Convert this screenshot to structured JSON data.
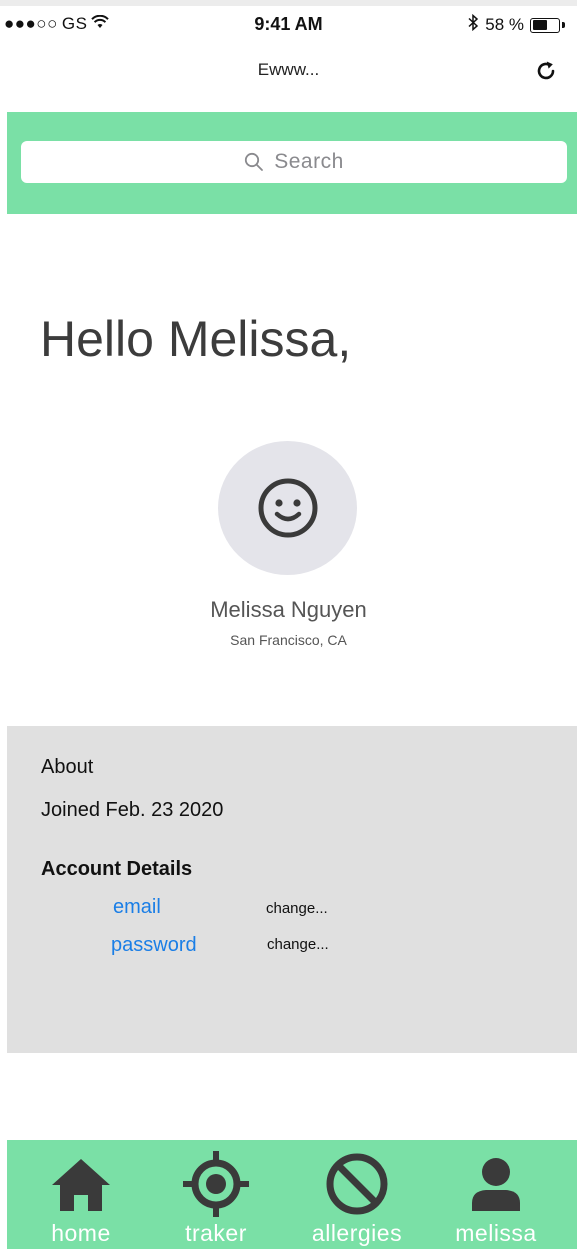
{
  "status_bar": {
    "signal": "●●●○○",
    "carrier": "GS",
    "time": "9:41 AM",
    "battery_percent_label": "58 %",
    "battery_level": 0.58
  },
  "nav": {
    "title": "Ewww..."
  },
  "search": {
    "placeholder": "Search"
  },
  "greeting": "Hello Melissa,",
  "profile": {
    "name": "Melissa Nguyen",
    "location": "San Francisco, CA"
  },
  "about": {
    "heading": "About",
    "joined": "Joined Feb. 23 2020",
    "account_heading": "Account Details",
    "fields": [
      {
        "label": "email",
        "action": "change..."
      },
      {
        "label": "password",
        "action": "change..."
      }
    ]
  },
  "tabs": [
    {
      "label": "home",
      "icon": "home-icon"
    },
    {
      "label": "traker",
      "icon": "crosshair-icon"
    },
    {
      "label": "allergies",
      "icon": "prohibited-icon"
    },
    {
      "label": "melissa",
      "icon": "person-icon"
    }
  ],
  "colors": {
    "accent_green": "#7ae0a6",
    "link_blue": "#1a7ee6",
    "panel_gray": "#e0e0e0",
    "avatar_bg": "#e4e4ea"
  }
}
